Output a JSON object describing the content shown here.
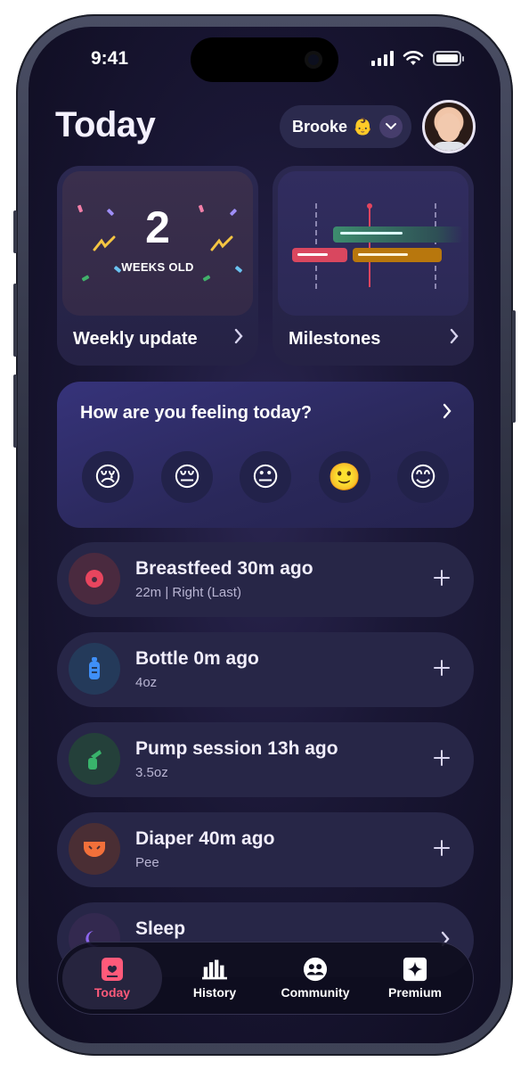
{
  "status": {
    "time": "9:41"
  },
  "header": {
    "title": "Today",
    "baby_name": "Brooke",
    "baby_emoji": "👶"
  },
  "cards": {
    "weekly": {
      "number": "2",
      "sub": "WEEKS OLD",
      "label": "Weekly update"
    },
    "milestones": {
      "label": "Milestones"
    }
  },
  "feeling": {
    "title": "How are you feeling today?",
    "emojis": [
      "😢",
      "😔",
      "😐",
      "🙂",
      "😊"
    ]
  },
  "activities": [
    {
      "title": "Breastfeed 30m ago",
      "sub": "22m | Right (Last)",
      "icon": "breastfeed-icon"
    },
    {
      "title": "Bottle 0m ago",
      "sub": "4oz",
      "icon": "bottle-icon"
    },
    {
      "title": "Pump session 13h ago",
      "sub": "3.5oz",
      "icon": "pump-icon"
    },
    {
      "title": "Diaper 40m ago",
      "sub": "Pee",
      "icon": "diaper-icon"
    },
    {
      "title": "Sleep",
      "sub": "",
      "icon": "moon-icon"
    }
  ],
  "tabs": [
    {
      "label": "Today",
      "icon": "today-icon",
      "color": "#ff5a7a"
    },
    {
      "label": "History",
      "icon": "chart-icon",
      "color": "#ffffff"
    },
    {
      "label": "Community",
      "icon": "people-icon",
      "color": "#ffffff"
    },
    {
      "label": "Premium",
      "icon": "sparkle-icon",
      "color": "#ffffff"
    }
  ],
  "colors": {
    "accent": "#ff5a7a",
    "background": "#1a1735"
  }
}
